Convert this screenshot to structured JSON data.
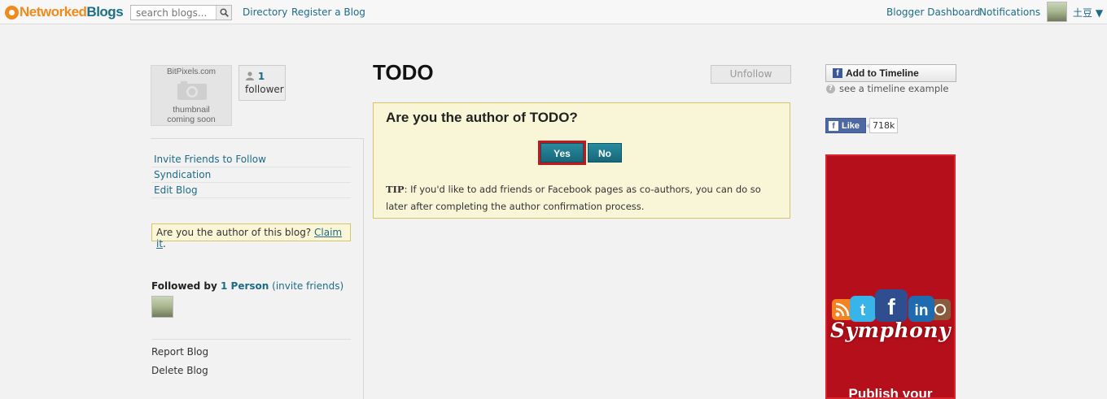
{
  "app": {
    "name_part1": "Networked",
    "name_part2": "Blogs"
  },
  "search": {
    "placeholder": "search blogs...",
    "value": ""
  },
  "nav": {
    "directory": "Directory",
    "register": "Register a Blog",
    "dashboard": "Blogger Dashboard",
    "notifications": "Notifications"
  },
  "user": {
    "name": "土豆 ▼"
  },
  "blog": {
    "thumbnail": {
      "site": "BitPixels.com",
      "line1": "thumbnail",
      "line2": "coming soon"
    },
    "followers": {
      "count": "1",
      "label": "follower"
    },
    "title": "TODO",
    "unfollow_label": "Unfollow"
  },
  "side_links": [
    "Invite Friends to Follow",
    "Syndication",
    "Edit Blog"
  ],
  "claim": {
    "text": "Are you the author of this blog? ",
    "link": "Claim it",
    "suffix": "."
  },
  "followed": {
    "prefix": "Followed by ",
    "count": "1 Person",
    "invite": "(invite friends)"
  },
  "bottom_links": [
    "Report Blog",
    "Delete Blog"
  ],
  "author_prompt": {
    "question": "Are you the author of TODO?",
    "yes": "Yes",
    "no": "No",
    "tip_label": "TIP",
    "tip_text": ": If you'd like to add friends or Facebook pages as co-authors, you can do so later after completing the author confirmation process."
  },
  "right": {
    "timeline_btn": "Add to Timeline",
    "timeline_example": "see a timeline example",
    "like_label": "Like",
    "like_count": "718k"
  },
  "ad": {
    "brand": "Symphony",
    "cta": "Publish your"
  },
  "colors": {
    "link": "#1d6b87",
    "button": "#176779",
    "highlight": "#c4161c",
    "notice_bg": "#f9f5d7",
    "ad_bg": "#b50f1b"
  }
}
